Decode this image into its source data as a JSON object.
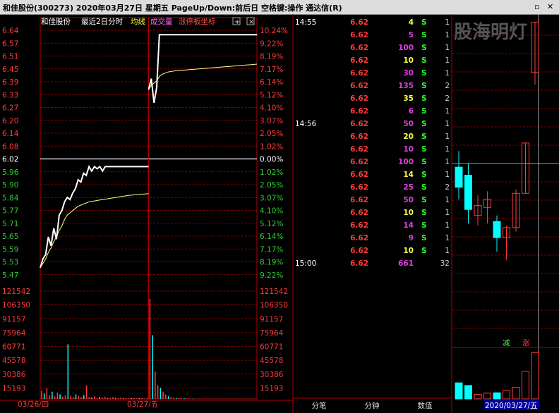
{
  "window": {
    "title": "和佳股份(300273)  2020年03月27日 星期五  PageUp/Down:前后日 空格键:操作 通达信(R)",
    "controls": [
      "▫",
      "✕"
    ]
  },
  "colors": {
    "up": "#ff3b3b",
    "down": "#00ffff",
    "flat": "#ffffff",
    "grid": "#b00000",
    "avg": "#ffff80",
    "vol_up": "#ff3b3b",
    "vol_down": "#00ffff",
    "buy": "#ff4040",
    "sell": "#e040e0"
  },
  "chart_header": {
    "stock": "和佳股份",
    "period": "最近2日分时",
    "avg_label": "均线",
    "vol_label": "成交量",
    "limit_label": "涨停板坐标",
    "add_icon": "plus-icon",
    "close_icon": "close-icon"
  },
  "chart_data": {
    "type": "line",
    "title": "最近2日分时",
    "price_ticks": [
      "6.64",
      "6.57",
      "6.51",
      "6.45",
      "6.39",
      "6.33",
      "6.27",
      "6.20",
      "6.14",
      "6.08",
      "6.02",
      "5.96",
      "5.90",
      "5.84",
      "5.77",
      "5.71",
      "5.65",
      "5.59",
      "5.53",
      "5.47"
    ],
    "pct_ticks": [
      "10.24%",
      "9.22%",
      "8.19%",
      "7.17%",
      "6.14%",
      "5.12%",
      "4.10%",
      "3.07%",
      "2.05%",
      "1.02%",
      "0.00%",
      "1.02%",
      "2.05%",
      "3.07%",
      "4.10%",
      "5.12%",
      "6.14%",
      "7.17%",
      "8.19%",
      "9.22%"
    ],
    "prev_close": 6.02,
    "ylim": [
      5.47,
      6.64
    ],
    "day1_label": "03/26/四",
    "day2_label": "03/27/五",
    "day1_price": [
      5.56,
      5.6,
      5.62,
      5.7,
      5.66,
      5.74,
      5.69,
      5.8,
      5.82,
      5.86,
      5.88,
      5.87,
      5.9,
      5.92,
      5.96,
      5.95,
      5.99,
      5.98,
      6.02,
      6.0,
      6.02,
      6.01,
      6.02,
      6.0,
      6.02,
      6.02,
      6.02,
      6.02,
      6.02,
      6.02,
      6.02,
      6.02,
      6.02,
      6.02,
      6.02,
      6.02,
      6.02,
      6.02,
      6.02,
      6.02,
      6.02
    ],
    "day1_avg": [
      5.56,
      5.58,
      5.6,
      5.63,
      5.65,
      5.68,
      5.7,
      5.73,
      5.75,
      5.78,
      5.8,
      5.81,
      5.82,
      5.83,
      5.84,
      5.845,
      5.85,
      5.855,
      5.86,
      5.862,
      5.864,
      5.866,
      5.868,
      5.87,
      5.872,
      5.874,
      5.876,
      5.878,
      5.88,
      5.882,
      5.884,
      5.886,
      5.888,
      5.89,
      5.891,
      5.892,
      5.893,
      5.894,
      5.895,
      5.896,
      5.897
    ],
    "day2_price": [
      6.37,
      6.42,
      6.31,
      6.38,
      6.62,
      6.62,
      6.62,
      6.62,
      6.62,
      6.62,
      6.62,
      6.62,
      6.62,
      6.62,
      6.62,
      6.62,
      6.62,
      6.62,
      6.62,
      6.62,
      6.62,
      6.62,
      6.62,
      6.62,
      6.62,
      6.62,
      6.62,
      6.62,
      6.62,
      6.62,
      6.62,
      6.62,
      6.62,
      6.62,
      6.62,
      6.62,
      6.62,
      6.62,
      6.62,
      6.62,
      6.62
    ],
    "day2_avg": [
      6.37,
      6.39,
      6.4,
      6.41,
      6.43,
      6.44,
      6.445,
      6.45,
      6.452,
      6.454,
      6.456,
      6.457,
      6.458,
      6.459,
      6.46,
      6.461,
      6.462,
      6.463,
      6.464,
      6.465,
      6.466,
      6.467,
      6.468,
      6.469,
      6.47,
      6.471,
      6.472,
      6.473,
      6.474,
      6.475,
      6.476,
      6.477,
      6.478,
      6.479,
      6.48,
      6.481,
      6.482,
      6.483,
      6.484,
      6.485,
      6.486
    ],
    "vol_ticks": [
      "121542",
      "106350",
      "91157",
      "75964",
      "60771",
      "45578",
      "30386",
      "15193"
    ],
    "vol_ylim": [
      0,
      121542
    ],
    "day1_volume": [
      9000,
      6000,
      12000,
      4000,
      8000,
      3000,
      7000,
      5000,
      2500,
      4000,
      60000,
      3000,
      2000,
      5000,
      3000,
      2000,
      4000,
      15000,
      2000,
      1500,
      3000,
      1000,
      2000,
      1500,
      2500,
      1000,
      1200,
      2000,
      1000,
      800,
      1500,
      900,
      1200,
      700,
      1000,
      800,
      600,
      900,
      700,
      500,
      600
    ],
    "day2_volume": [
      110000,
      70000,
      30000,
      15000,
      12000,
      8000,
      5000,
      3000,
      2000,
      1500,
      1000,
      800,
      700,
      600,
      500,
      400,
      300,
      300,
      200,
      200,
      200,
      150,
      150,
      150,
      100,
      100,
      100,
      100,
      100,
      100,
      100,
      100,
      100,
      100,
      100,
      100,
      100,
      100,
      100,
      100,
      100
    ]
  },
  "ticks": {
    "rows": [
      {
        "time": "14:55",
        "price": "6.62",
        "vol": "4",
        "bs": "S",
        "n": "1"
      },
      {
        "time": "",
        "price": "6.62",
        "vol": "5",
        "bs": "S",
        "n": "1"
      },
      {
        "time": "",
        "price": "6.62",
        "vol": "100",
        "bs": "S",
        "n": "1"
      },
      {
        "time": "",
        "price": "6.62",
        "vol": "10",
        "bs": "S",
        "n": "1"
      },
      {
        "time": "",
        "price": "6.62",
        "vol": "30",
        "bs": "S",
        "n": "1"
      },
      {
        "time": "",
        "price": "6.62",
        "vol": "135",
        "bs": "S",
        "n": "2"
      },
      {
        "time": "",
        "price": "6.62",
        "vol": "35",
        "bs": "S",
        "n": "2"
      },
      {
        "time": "",
        "price": "6.62",
        "vol": "6",
        "bs": "S",
        "n": "1"
      },
      {
        "time": "14:56",
        "price": "6.62",
        "vol": "50",
        "bs": "S",
        "n": "1"
      },
      {
        "time": "",
        "price": "6.62",
        "vol": "20",
        "bs": "S",
        "n": "1"
      },
      {
        "time": "",
        "price": "6.62",
        "vol": "10",
        "bs": "S",
        "n": "1"
      },
      {
        "time": "",
        "price": "6.62",
        "vol": "100",
        "bs": "S",
        "n": "1"
      },
      {
        "time": "",
        "price": "6.62",
        "vol": "14",
        "bs": "S",
        "n": "1"
      },
      {
        "time": "",
        "price": "6.62",
        "vol": "25",
        "bs": "S",
        "n": "2"
      },
      {
        "time": "",
        "price": "6.62",
        "vol": "50",
        "bs": "S",
        "n": "1"
      },
      {
        "time": "",
        "price": "6.62",
        "vol": "10",
        "bs": "S",
        "n": "1"
      },
      {
        "time": "",
        "price": "6.62",
        "vol": "14",
        "bs": "S",
        "n": "1"
      },
      {
        "time": "",
        "price": "6.62",
        "vol": "9",
        "bs": "S",
        "n": "1"
      },
      {
        "time": "",
        "price": "6.62",
        "vol": "10",
        "bs": "S",
        "n": "1"
      },
      {
        "time": "15:00",
        "price": "6.62",
        "vol": "661",
        "bs": "",
        "n": "32"
      }
    ],
    "tabs": [
      "分笔",
      "分钟",
      "数值"
    ]
  },
  "kline": {
    "watermark": "股海明灯",
    "last_price": "6.62",
    "reduce_label": "减",
    "raise_label": "涨",
    "date_label": "2020/03/27/五",
    "candles": [
      {
        "o": 5.9,
        "c": 5.8,
        "h": 5.98,
        "l": 5.74,
        "up": false
      },
      {
        "o": 5.86,
        "c": 5.69,
        "h": 5.92,
        "l": 5.62,
        "up": false
      },
      {
        "o": 5.66,
        "c": 5.71,
        "h": 5.76,
        "l": 5.61,
        "up": true
      },
      {
        "o": 5.7,
        "c": 5.74,
        "h": 5.78,
        "l": 5.62,
        "up": true
      },
      {
        "o": 5.63,
        "c": 5.55,
        "h": 5.66,
        "l": 5.48,
        "up": false
      },
      {
        "o": 5.55,
        "c": 5.6,
        "h": 5.61,
        "l": 5.44,
        "up": true
      },
      {
        "o": 5.6,
        "c": 5.77,
        "h": 5.79,
        "l": 5.58,
        "up": true
      },
      {
        "o": 5.77,
        "c": 6.02,
        "h": 6.02,
        "l": 5.77,
        "up": true
      },
      {
        "o": 6.37,
        "c": 6.62,
        "h": 6.62,
        "l": 6.31,
        "up": true
      }
    ],
    "volumes": [
      42000,
      35000,
      12000,
      15000,
      16000,
      22000,
      30000,
      72000,
      121000
    ]
  }
}
